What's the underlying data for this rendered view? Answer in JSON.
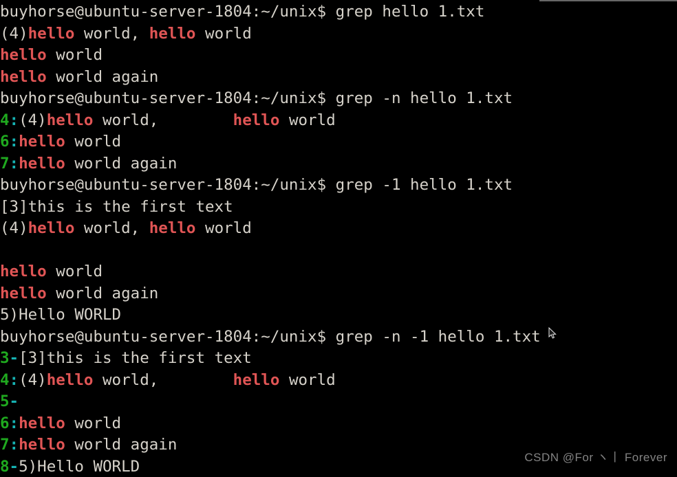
{
  "terminal": {
    "background_color": "#000000",
    "foreground_color": "#d6d2ca",
    "match_color": "#e05555",
    "lineno_color": "#1fa81f",
    "separator_color": "#16b2b2",
    "prompt": "buyhorse@ubuntu-server-1804:~/unix$",
    "lines": [
      {
        "id": "line-1",
        "type": "command",
        "segments": [
          {
            "text": "buyhorse@ubuntu-server-1804:~/unix$ grep hello 1.txt",
            "color": "default"
          }
        ]
      },
      {
        "id": "line-2",
        "type": "output",
        "segments": [
          {
            "text": "(4)",
            "color": "default"
          },
          {
            "text": "hello",
            "color": "match"
          },
          {
            "text": " world, ",
            "color": "default"
          },
          {
            "text": "hello",
            "color": "match"
          },
          {
            "text": " world",
            "color": "default"
          }
        ]
      },
      {
        "id": "line-3",
        "type": "output",
        "segments": [
          {
            "text": "hello",
            "color": "match"
          },
          {
            "text": " world",
            "color": "default"
          }
        ]
      },
      {
        "id": "line-4",
        "type": "output",
        "segments": [
          {
            "text": "hello",
            "color": "match"
          },
          {
            "text": " world again",
            "color": "default"
          }
        ]
      },
      {
        "id": "line-5",
        "type": "command",
        "segments": [
          {
            "text": "buyhorse@ubuntu-server-1804:~/unix$ grep -n hello 1.txt",
            "color": "default"
          }
        ]
      },
      {
        "id": "line-6",
        "type": "output",
        "segments": [
          {
            "text": "4",
            "color": "lineno"
          },
          {
            "text": ":",
            "color": "separator"
          },
          {
            "text": "(4)",
            "color": "default"
          },
          {
            "text": "hello",
            "color": "match"
          },
          {
            "text": " world,        ",
            "color": "default"
          },
          {
            "text": "hello",
            "color": "match"
          },
          {
            "text": " world",
            "color": "default"
          }
        ]
      },
      {
        "id": "line-7",
        "type": "output",
        "segments": [
          {
            "text": "6",
            "color": "lineno"
          },
          {
            "text": ":",
            "color": "separator"
          },
          {
            "text": "hello",
            "color": "match"
          },
          {
            "text": " world",
            "color": "default"
          }
        ]
      },
      {
        "id": "line-8",
        "type": "output",
        "segments": [
          {
            "text": "7",
            "color": "lineno"
          },
          {
            "text": ":",
            "color": "separator"
          },
          {
            "text": "hello",
            "color": "match"
          },
          {
            "text": " world again",
            "color": "default"
          }
        ]
      },
      {
        "id": "line-9",
        "type": "command",
        "segments": [
          {
            "text": "buyhorse@ubuntu-server-1804:~/unix$ grep -1 hello 1.txt",
            "color": "default"
          }
        ]
      },
      {
        "id": "line-10",
        "type": "output",
        "segments": [
          {
            "text": "[3]this is the first text",
            "color": "default"
          }
        ]
      },
      {
        "id": "line-11",
        "type": "output",
        "segments": [
          {
            "text": "(4)",
            "color": "default"
          },
          {
            "text": "hello",
            "color": "match"
          },
          {
            "text": " world, ",
            "color": "default"
          },
          {
            "text": "hello",
            "color": "match"
          },
          {
            "text": " world",
            "color": "default"
          }
        ]
      },
      {
        "id": "line-12",
        "type": "output",
        "segments": [
          {
            "text": " ",
            "color": "default"
          }
        ]
      },
      {
        "id": "line-13",
        "type": "output",
        "segments": [
          {
            "text": "hello",
            "color": "match"
          },
          {
            "text": " world",
            "color": "default"
          }
        ]
      },
      {
        "id": "line-14",
        "type": "output",
        "segments": [
          {
            "text": "hello",
            "color": "match"
          },
          {
            "text": " world again",
            "color": "default"
          }
        ]
      },
      {
        "id": "line-15",
        "type": "output",
        "segments": [
          {
            "text": "5)Hello WORLD",
            "color": "default"
          }
        ]
      },
      {
        "id": "line-16",
        "type": "command",
        "segments": [
          {
            "text": "buyhorse@ubuntu-server-1804:~/unix$ grep -n -1 hello 1.txt",
            "color": "default"
          }
        ]
      },
      {
        "id": "line-17",
        "type": "output",
        "segments": [
          {
            "text": "3",
            "color": "lineno"
          },
          {
            "text": "-",
            "color": "separator"
          },
          {
            "text": "[3]this is the first text",
            "color": "default"
          }
        ]
      },
      {
        "id": "line-18",
        "type": "output",
        "segments": [
          {
            "text": "4",
            "color": "lineno"
          },
          {
            "text": ":",
            "color": "separator"
          },
          {
            "text": "(4)",
            "color": "default"
          },
          {
            "text": "hello",
            "color": "match"
          },
          {
            "text": " world,        ",
            "color": "default"
          },
          {
            "text": "hello",
            "color": "match"
          },
          {
            "text": " world",
            "color": "default"
          }
        ]
      },
      {
        "id": "line-19",
        "type": "output",
        "segments": [
          {
            "text": "5",
            "color": "lineno"
          },
          {
            "text": "-",
            "color": "separator"
          }
        ]
      },
      {
        "id": "line-20",
        "type": "output",
        "segments": [
          {
            "text": "6",
            "color": "lineno"
          },
          {
            "text": ":",
            "color": "separator"
          },
          {
            "text": "hello",
            "color": "match"
          },
          {
            "text": " world",
            "color": "default"
          }
        ]
      },
      {
        "id": "line-21",
        "type": "output",
        "segments": [
          {
            "text": "7",
            "color": "lineno"
          },
          {
            "text": ":",
            "color": "separator"
          },
          {
            "text": "hello",
            "color": "match"
          },
          {
            "text": " world again",
            "color": "default"
          }
        ]
      },
      {
        "id": "line-22",
        "type": "output",
        "segments": [
          {
            "text": "8",
            "color": "lineno"
          },
          {
            "text": "-",
            "color": "separator"
          },
          {
            "text": "5)Hello WORLD",
            "color": "default"
          }
        ]
      }
    ]
  },
  "watermark": {
    "text": "CSDN @For ヽ丨 Forever"
  },
  "cursor": {
    "type": "mouse-pointer"
  }
}
